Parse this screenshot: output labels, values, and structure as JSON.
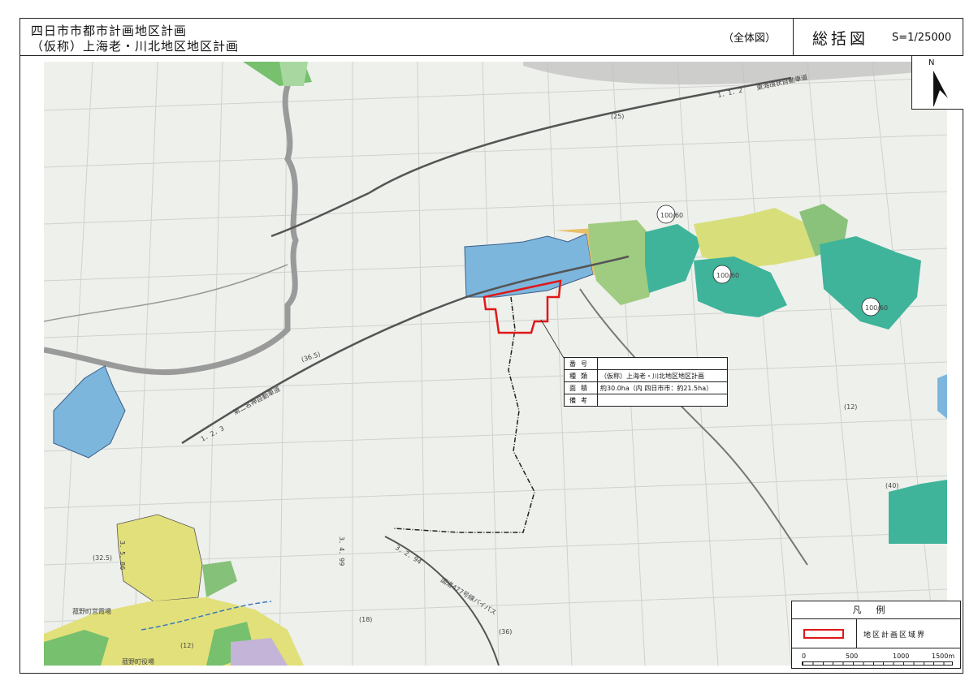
{
  "header": {
    "title_line1": "四日市市都市計画地区計画",
    "title_line2": "（仮称）上海老・川北地区地区計画",
    "scope": "（全体図）",
    "summary": "総括図",
    "scale": "S=1/25000"
  },
  "north": {
    "label": "N"
  },
  "info_table": {
    "rows": [
      {
        "key": "番号",
        "value": ""
      },
      {
        "key": "種類",
        "value": "（仮称）上海老・川北地区地区計画"
      },
      {
        "key": "面積",
        "value": "約30.0ha（内 四日市市：約21.5ha）"
      },
      {
        "key": "備考",
        "value": ""
      }
    ]
  },
  "legend": {
    "title": "凡例",
    "item_label": "地区計画区域界",
    "scale_ticks": [
      "0",
      "500",
      "1000",
      "1500m"
    ],
    "colors": {
      "boundary": "#e01818"
    }
  },
  "map_labels": {
    "expressway": "東海環状自動車道",
    "meishin": "第二名神自動車道",
    "bypass": "国道477号線バイパス",
    "route_1_2_3": "1．2．3",
    "route_36_5": "(36.5)",
    "route_3_2_94": "3．2．94",
    "route_36": "(36)",
    "route_3_4_99": "3．4．99",
    "route_18": "(18)",
    "route_3_5_86": "3．5．86",
    "route_32_5": "(32.5)",
    "route_12a": "(12)",
    "route_12b": "(12)",
    "route_40": "(40)",
    "route_25": "(25)",
    "route_1_1_2": "1．1．2",
    "ratio_1": "100/60",
    "ratio_2": "100/60",
    "ratio_3": "100/60",
    "komono": "菰野町役場",
    "komono_station": "菰野町営霞場"
  },
  "colors": {
    "map_bg": "#eef0ec",
    "blue_zone": "#7db6dd",
    "green_zone": "#86c17a",
    "teal_zone": "#3fb49a",
    "yellow_zone": "#e2e07a",
    "district_boundary": "#e01818"
  }
}
